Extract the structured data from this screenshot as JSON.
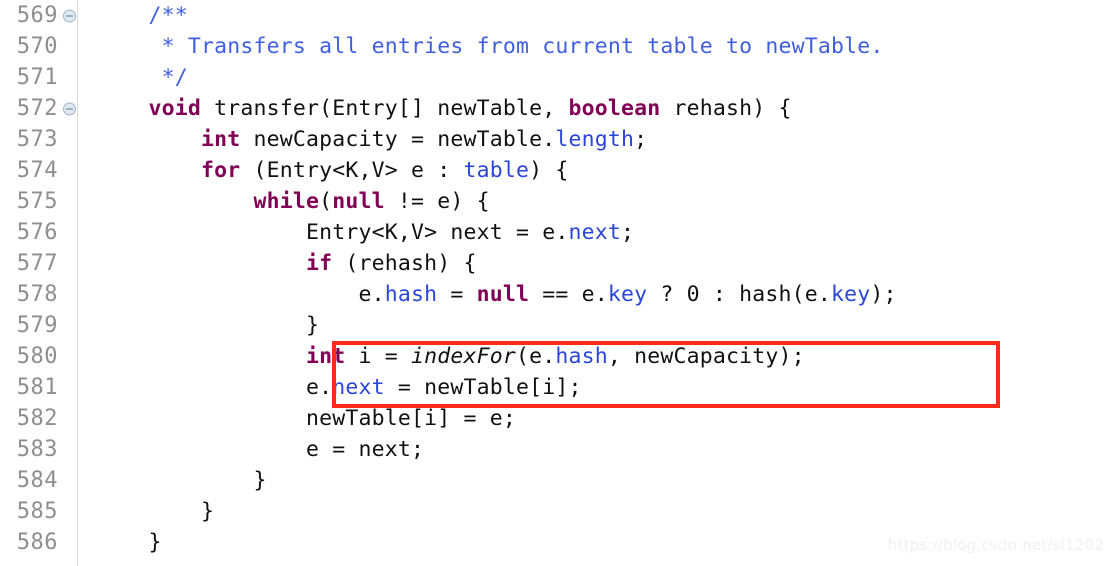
{
  "editor": {
    "title": "Java source editor",
    "language": "Java",
    "first_line_number": 569,
    "colors": {
      "background": "#ffffff",
      "keyword": "#7f0055",
      "comment": "#3f5fdf",
      "field": "#2a45d8",
      "plain": "#111111",
      "line_number": "#8e8e93",
      "highlight_box": "#fb2b1c",
      "gutter_border": "#dcdcdc",
      "fold_marker_fill": "#dfe7ef",
      "fold_marker_border": "#9fb3c8",
      "watermark": "#f0f0f0"
    }
  },
  "gutter": {
    "name": "line-number-gutter",
    "rows": [
      {
        "number": "569",
        "fold": true
      },
      {
        "number": "570",
        "fold": false
      },
      {
        "number": "571",
        "fold": false
      },
      {
        "number": "572",
        "fold": true
      },
      {
        "number": "573",
        "fold": false
      },
      {
        "number": "574",
        "fold": false
      },
      {
        "number": "575",
        "fold": false
      },
      {
        "number": "576",
        "fold": false
      },
      {
        "number": "577",
        "fold": false
      },
      {
        "number": "578",
        "fold": false
      },
      {
        "number": "579",
        "fold": false
      },
      {
        "number": "580",
        "fold": false
      },
      {
        "number": "581",
        "fold": false
      },
      {
        "number": "582",
        "fold": false
      },
      {
        "number": "583",
        "fold": false
      },
      {
        "number": "584",
        "fold": false
      },
      {
        "number": "585",
        "fold": false
      },
      {
        "number": "586",
        "fold": false
      }
    ]
  },
  "code": {
    "lines": [
      {
        "line": "569",
        "plain_text": "    /**",
        "tokens": [
          {
            "t": "    ",
            "k": "plain"
          },
          {
            "t": "/**",
            "k": "comment"
          }
        ]
      },
      {
        "line": "570",
        "plain_text": "     * Transfers all entries from current table to newTable.",
        "tokens": [
          {
            "t": "     ",
            "k": "plain"
          },
          {
            "t": "* Transfers all entries from current table to newTable.",
            "k": "comment"
          }
        ]
      },
      {
        "line": "571",
        "plain_text": "     */",
        "tokens": [
          {
            "t": "     ",
            "k": "plain"
          },
          {
            "t": "*/",
            "k": "comment"
          }
        ]
      },
      {
        "line": "572",
        "plain_text": "    void transfer(Entry[] newTable, boolean rehash) {",
        "tokens": [
          {
            "t": "    ",
            "k": "plain"
          },
          {
            "t": "void",
            "k": "kw"
          },
          {
            "t": " transfer(Entry[] newTable, ",
            "k": "plain"
          },
          {
            "t": "boolean",
            "k": "kw"
          },
          {
            "t": " rehash) {",
            "k": "plain"
          }
        ]
      },
      {
        "line": "573",
        "plain_text": "        int newCapacity = newTable.length;",
        "tokens": [
          {
            "t": "        ",
            "k": "plain"
          },
          {
            "t": "int",
            "k": "kw"
          },
          {
            "t": " newCapacity = newTable.",
            "k": "plain"
          },
          {
            "t": "length",
            "k": "field"
          },
          {
            "t": ";",
            "k": "plain"
          }
        ]
      },
      {
        "line": "574",
        "plain_text": "        for (Entry<K,V> e : table) {",
        "tokens": [
          {
            "t": "        ",
            "k": "plain"
          },
          {
            "t": "for",
            "k": "kw"
          },
          {
            "t": " (Entry<K,V> e : ",
            "k": "plain"
          },
          {
            "t": "table",
            "k": "field"
          },
          {
            "t": ") {",
            "k": "plain"
          }
        ]
      },
      {
        "line": "575",
        "plain_text": "            while(null != e) {",
        "tokens": [
          {
            "t": "            ",
            "k": "plain"
          },
          {
            "t": "while",
            "k": "kw"
          },
          {
            "t": "(",
            "k": "plain"
          },
          {
            "t": "null",
            "k": "kw"
          },
          {
            "t": " != e) {",
            "k": "plain"
          }
        ]
      },
      {
        "line": "576",
        "plain_text": "                Entry<K,V> next = e.next;",
        "tokens": [
          {
            "t": "                Entry<K,V> next = e.",
            "k": "plain"
          },
          {
            "t": "next",
            "k": "field"
          },
          {
            "t": ";",
            "k": "plain"
          }
        ]
      },
      {
        "line": "577",
        "plain_text": "                if (rehash) {",
        "tokens": [
          {
            "t": "                ",
            "k": "plain"
          },
          {
            "t": "if",
            "k": "kw"
          },
          {
            "t": " (rehash) {",
            "k": "plain"
          }
        ]
      },
      {
        "line": "578",
        "plain_text": "                    e.hash = null == e.key ? 0 : hash(e.key);",
        "tokens": [
          {
            "t": "                    e.",
            "k": "plain"
          },
          {
            "t": "hash",
            "k": "field"
          },
          {
            "t": " = ",
            "k": "plain"
          },
          {
            "t": "null",
            "k": "kw"
          },
          {
            "t": " == e.",
            "k": "plain"
          },
          {
            "t": "key",
            "k": "field"
          },
          {
            "t": " ? 0 : hash(e.",
            "k": "plain"
          },
          {
            "t": "key",
            "k": "field"
          },
          {
            "t": ");",
            "k": "plain"
          }
        ]
      },
      {
        "line": "579",
        "plain_text": "                }",
        "tokens": [
          {
            "t": "                }",
            "k": "plain"
          }
        ]
      },
      {
        "line": "580",
        "plain_text": "                int i = indexFor(e.hash, newCapacity);",
        "tokens": [
          {
            "t": "                ",
            "k": "plain"
          },
          {
            "t": "int",
            "k": "kw"
          },
          {
            "t": " i = ",
            "k": "plain"
          },
          {
            "t": "indexFor",
            "k": "static"
          },
          {
            "t": "(e.",
            "k": "plain"
          },
          {
            "t": "hash",
            "k": "field"
          },
          {
            "t": ", newCapacity);",
            "k": "plain"
          }
        ]
      },
      {
        "line": "581",
        "plain_text": "                e.next = newTable[i];",
        "tokens": [
          {
            "t": "                e.",
            "k": "plain"
          },
          {
            "t": "next",
            "k": "field"
          },
          {
            "t": " = newTable[i];",
            "k": "plain"
          }
        ]
      },
      {
        "line": "582",
        "plain_text": "                newTable[i] = e;",
        "tokens": [
          {
            "t": "                newTable[i] = e;",
            "k": "plain"
          }
        ]
      },
      {
        "line": "583",
        "plain_text": "                e = next;",
        "tokens": [
          {
            "t": "                e = next;",
            "k": "plain"
          }
        ]
      },
      {
        "line": "584",
        "plain_text": "            }",
        "tokens": [
          {
            "t": "            }",
            "k": "plain"
          }
        ]
      },
      {
        "line": "585",
        "plain_text": "        }",
        "tokens": [
          {
            "t": "        }",
            "k": "plain"
          }
        ]
      },
      {
        "line": "586",
        "plain_text": "    }",
        "tokens": [
          {
            "t": "    }",
            "k": "plain"
          }
        ]
      }
    ]
  },
  "highlight": {
    "name": "red-annotation-box",
    "covers_lines": [
      "580",
      "581"
    ],
    "covered_code": [
      "int i = indexFor(e.hash, newCapacity);",
      "e.next = newTable[i];"
    ]
  },
  "watermark": {
    "text": "https://blog.csdn.net/sl1202"
  }
}
